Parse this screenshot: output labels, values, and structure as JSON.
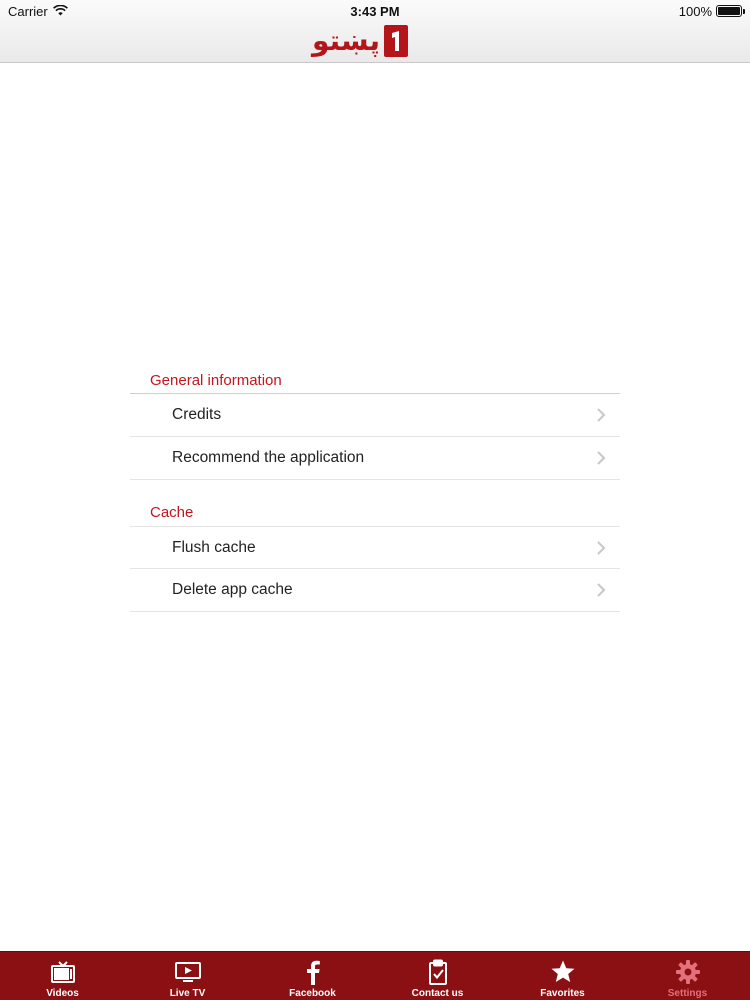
{
  "status_bar": {
    "carrier": "Carrier",
    "time": "3:43 PM",
    "battery": "100%",
    "battery_level": 1.0
  },
  "header": {
    "logo_text": "پښتو"
  },
  "sections": [
    {
      "title": "General information",
      "items": [
        {
          "label": "Credits"
        },
        {
          "label": "Recommend the application"
        }
      ]
    },
    {
      "title": "Cache",
      "items": [
        {
          "label": "Flush cache"
        },
        {
          "label": "Delete app cache"
        }
      ]
    }
  ],
  "tab_bar": {
    "tabs": [
      {
        "label": "Videos",
        "icon": "tv-icon"
      },
      {
        "label": "Live TV",
        "icon": "play-screen-icon"
      },
      {
        "label": "Facebook",
        "icon": "facebook-icon"
      },
      {
        "label": "Contact us",
        "icon": "clipboard-check-icon"
      },
      {
        "label": "Favorites",
        "icon": "star-icon"
      },
      {
        "label": "Settings",
        "icon": "gear-icon"
      }
    ],
    "active_index": 5
  },
  "colors": {
    "accent": "#c4161c",
    "tab_bar_bg": "#8b1014",
    "tab_active": "#e3707a"
  }
}
